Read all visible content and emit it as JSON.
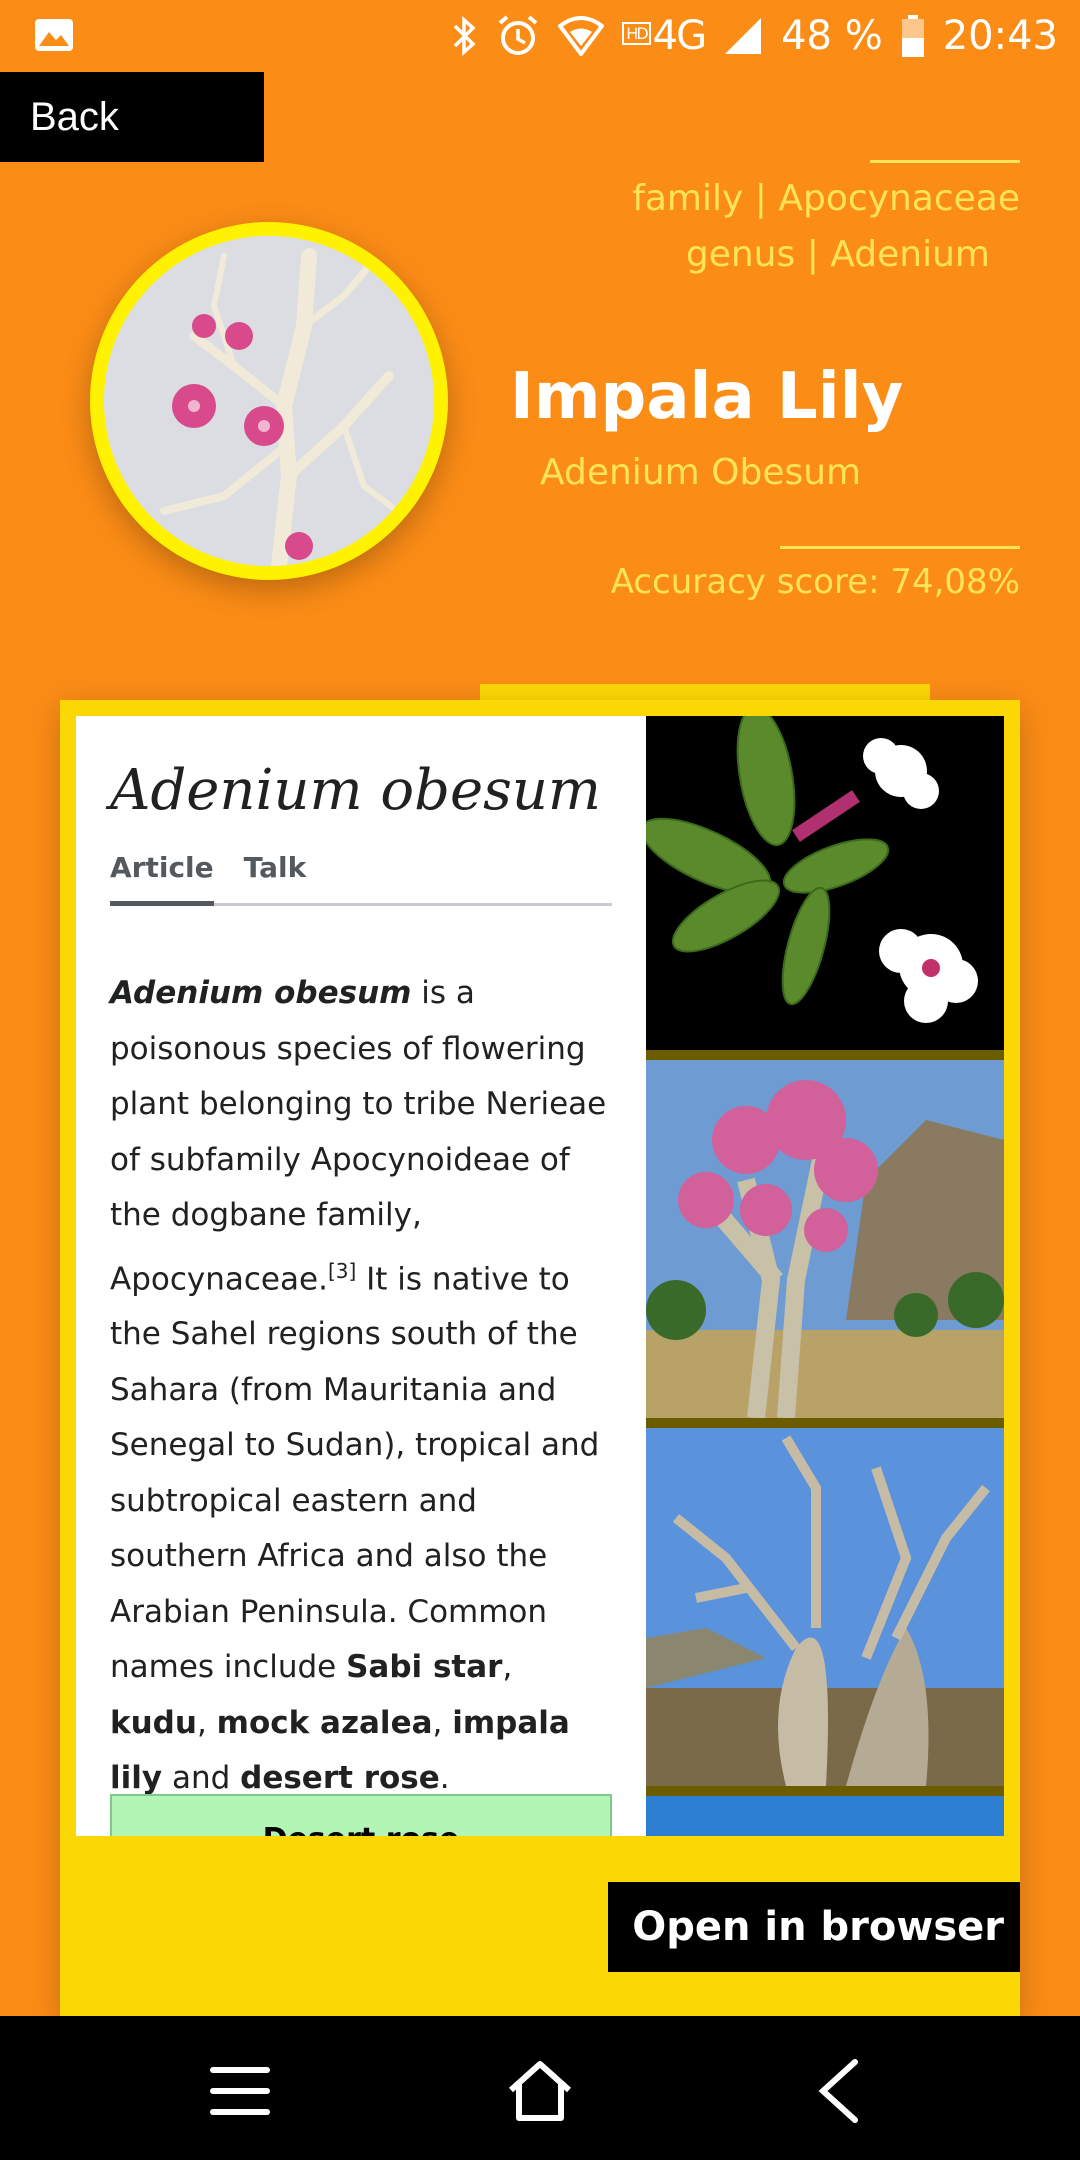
{
  "status": {
    "network": "4G",
    "battery": "48 %",
    "time": "20:43",
    "hd": "HD"
  },
  "back_label": "Back",
  "taxonomy": {
    "family_label": "family",
    "family": "Apocynaceae",
    "genus_label": "genus",
    "genus": "Adenium",
    "separator": "|"
  },
  "plant": {
    "common_name": "Impala Lily",
    "scientific_name": "Adenium Obesum",
    "accuracy": "Accuracy score: 74,08%"
  },
  "wiki": {
    "title": "Adenium obesum",
    "tabs": [
      "Article",
      "Talk"
    ],
    "lead_bold": "Adenium obesum",
    "text1": " is a poisonous species of flowering plant belonging to tribe Nerieae of subfamily Apocynoideae of the dogbane family, Apocynaceae.",
    "ref": "[3]",
    "text2": " It is native to the Sahel regions south of the Sahara (from Mauritania and Senegal to Sudan), tropical and subtropical eastern and southern Africa and also the Arabian Peninsula. Common names include ",
    "name1": "Sabi star",
    "sep1": ", ",
    "name2": "kudu",
    "sep2": ", ",
    "name3": "mock azalea",
    "sep3": ", ",
    "name4": "impala lily",
    "sep4": " and ",
    "name5": "desert rose",
    "end": ".",
    "infobox_label": "Desert rose"
  },
  "open_browser_label": "Open in browser",
  "colors": {
    "background": "#FB8C16",
    "accent": "#FFE45A",
    "card": "#FCD706",
    "avatar_ring": "#FFF200"
  },
  "icons": [
    "gallery-icon",
    "bluetooth-icon",
    "alarm-icon",
    "wifi-icon",
    "signal-icon",
    "battery-icon",
    "menu-icon",
    "home-icon",
    "back-arrow-icon"
  ]
}
